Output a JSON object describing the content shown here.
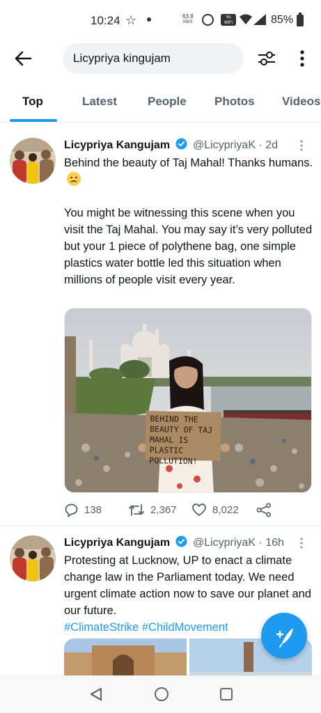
{
  "status_bar": {
    "time": "10:24",
    "net_speed_value": "63.8",
    "net_speed_unit": "KB/S",
    "volte_label": "Vo\nWiFi",
    "battery": "85%"
  },
  "search": {
    "query": "Licypriya kingujam"
  },
  "tabs": [
    {
      "label": "Top",
      "active": true
    },
    {
      "label": "Latest",
      "active": false
    },
    {
      "label": "People",
      "active": false
    },
    {
      "label": "Photos",
      "active": false
    },
    {
      "label": "Videos",
      "active": false
    }
  ],
  "tweets": [
    {
      "author_name": "Licypriya Kangujam",
      "handle_time": "@LicypriyaK · 2d",
      "text_line1": "Behind the beauty of Taj Mahal! Thanks humans.",
      "text_para2": "You might be witnessing this scene when you visit the Taj Mahal. You may say it’s very polluted but your 1 piece of polythene bag, one simple plastics water bottle led this situation when millions of people visit every year.",
      "sign_text": "BEHIND THE BEAUTY OF TAJ MAHAL IS PLASTIC POLLUTION!",
      "replies": "138",
      "retweets": "2,367",
      "likes": "8,022"
    },
    {
      "author_name": "Licypriya Kangujam",
      "handle_time": "@LicypriyaK · 16h",
      "text": "Protesting at Lucknow, UP  to enact a climate change law in the Parliament today. We need urgent climate action now to save our planet and our future.",
      "hashtags": "#ClimateStrike #ChildMovement"
    }
  ],
  "colors": {
    "accent": "#1d9bf0",
    "text_primary": "#0f1419",
    "text_secondary": "#536471"
  }
}
